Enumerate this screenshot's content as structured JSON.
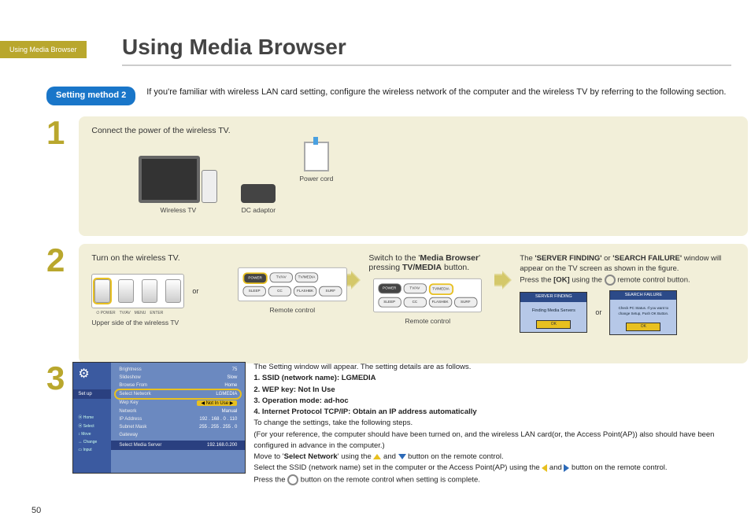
{
  "breadcrumb": "Using Media Browser",
  "title": "Using Media Browser",
  "badge": "Setting method 2",
  "intro": "If you're familiar with wireless LAN card setting, configure the wireless network of the computer and the wireless TV by referring to the following section.",
  "step1": {
    "num": "1",
    "text": "Connect the power of the wireless TV.",
    "labels": {
      "tv": "Wireless TV",
      "cord": "Power cord",
      "adaptor": "DC adaptor"
    }
  },
  "step2": {
    "num": "2",
    "col1": {
      "text": "Turn on the wireless TV.",
      "caption": "Upper side of the wireless TV",
      "or": "or"
    },
    "col2": {
      "caption": "Remote control"
    },
    "col3": {
      "pre": "Switch to the '",
      "strong": "Media Browser",
      "post": "' pressing ",
      "btn": "TV/MEDIA",
      "post2": " button.",
      "caption": "Remote control"
    },
    "col4": {
      "line_pre": "The ",
      "s1": "'SERVER FINDING'",
      "mid": " or ",
      "s2": "'SEARCH FAILURE'",
      "post": " window will appear on the TV screen as shown in the figure.",
      "line2_pre": "Press the ",
      "ok": "[OK]",
      "line2_mid": " using the ",
      "line2_post": " remote control button.",
      "m1": {
        "hd": "SERVER FINDING",
        "bd": "Finding Media Servers",
        "ok": "OK"
      },
      "or": "or",
      "m2": {
        "hd": "SEARCH FAILURE",
        "bd": "Check PC Status. If you want to change Setup, Push OK Button.",
        "ok": "OK"
      }
    },
    "remote": {
      "power": "POWER",
      "tvav": "TV/AV",
      "tvmedia": "TV/MEDIA",
      "sleep": "SLEEP",
      "cc": "CC",
      "flashbk": "FLASHBK",
      "surf": "SURF"
    }
  },
  "step3": {
    "num": "3",
    "setup": {
      "tab": "Set up",
      "rows": {
        "brightness": {
          "k": "Brightness",
          "v": "75"
        },
        "slideshow": {
          "k": "Slideshow",
          "v": "Slow"
        },
        "browse": {
          "k": "Browse From",
          "v": "Home"
        },
        "selnet": {
          "k": "Select Network",
          "v": "LGMEDIA"
        },
        "wep": {
          "k": "Wep Key",
          "v": "Not In Use"
        },
        "network": {
          "k": "Network",
          "v": "Manual"
        },
        "ip": {
          "k": "IP Address",
          "v": "192 . 168 . 0 . 110"
        },
        "subnet": {
          "k": "Subnet Mask",
          "v": "255 . 255 . 255 . 0"
        },
        "gateway": {
          "k": "Gateway",
          "v": ""
        },
        "mediasrv": {
          "k": "Select Media Server",
          "v": "192.168.0.200"
        }
      },
      "mini": {
        "home": "Home",
        "select": "Select",
        "move": "Move",
        "change": "Change",
        "input": "Input"
      }
    },
    "body": {
      "l1": "The Setting window will appear. The setting details are as follows.",
      "d1": "1. SSID (network name): LGMEDIA",
      "d2": "2. WEP key: Not In Use",
      "d3": "3. Operation mode: ad-hoc",
      "d4": "4. Internet Protocol TCP/IP: Obtain an IP address automatically",
      "l2": "To change the settings, take the following steps.",
      "l3": "(For your reference, the computer should have been turned on, and the wireless LAN card(or, the Access Point(AP)) also should have been configured in advance in the computer.)",
      "l4a": "Move to '",
      "l4s": "Select Network",
      "l4b": "' using the ",
      "l4c": " and ",
      "l4d": " button on the remote control.",
      "l5a": "Select the SSID (network name) set in the computer or the Access Point(AP) using the ",
      "l5b": " and ",
      "l5c": " button on the remote control.",
      "l6a": "Press the ",
      "l6b": " button on the remote control when setting is complete."
    }
  },
  "pagenum": "50"
}
